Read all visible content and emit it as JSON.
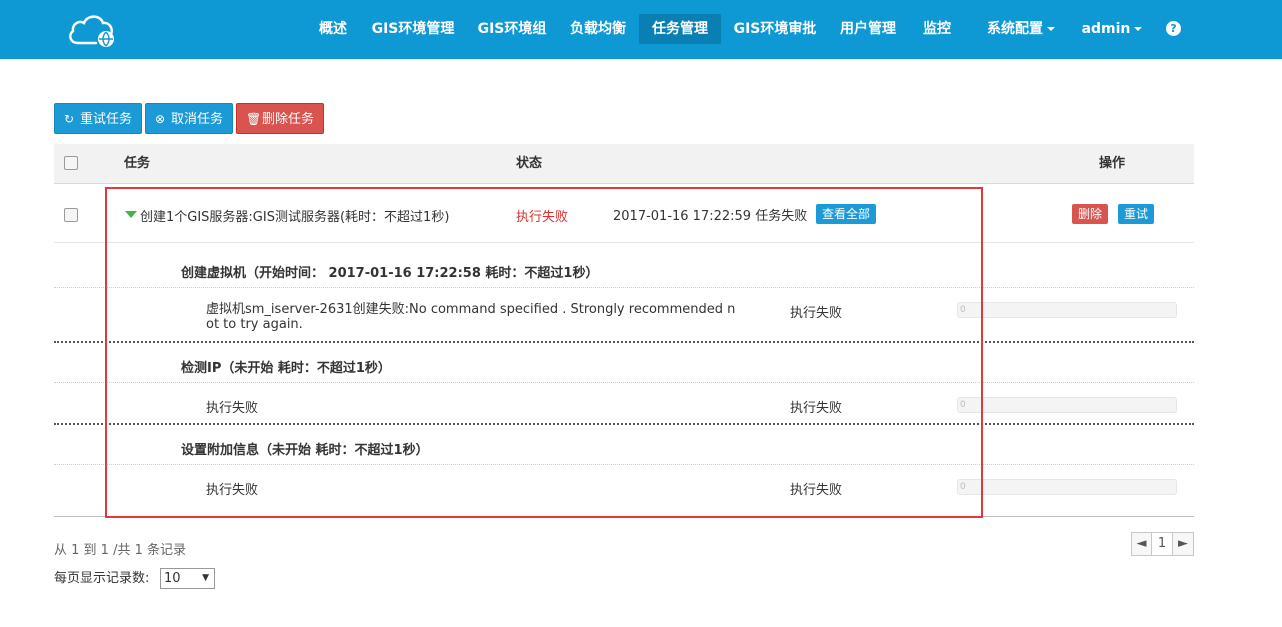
{
  "nav": {
    "items": [
      "概述",
      "GIS环境管理",
      "GIS环境组",
      "负载均衡",
      "任务管理",
      "GIS环境审批",
      "用户管理",
      "监控"
    ],
    "system_config": "系统配置",
    "user": "admin",
    "help": "?",
    "active": "任务管理"
  },
  "toolbar": {
    "retry": "重试任务",
    "cancel": "取消任务",
    "delete": "删除任务"
  },
  "table": {
    "headers": {
      "task": "任务",
      "status": "状态",
      "actions": "操作"
    },
    "task": {
      "name": "创建1个GIS服务器:GIS测试服务器(耗时：不超过1秒)",
      "status": "执行失败",
      "message": "2017-01-16 17:22:59 任务失败",
      "view_all": "查看全部",
      "delete": "删除",
      "retry": "重试"
    },
    "steps": [
      {
        "title": "创建虚拟机（开始时间： 2017-01-16 17:22:58 耗时：不超过1秒）",
        "detail_line1": "虚拟机sm_iserver-2631创建失败:No command specified . Strongly recommended n",
        "detail_line2": "ot to try again.",
        "status": "执行失败",
        "progress": 0,
        "progress_label": "0"
      },
      {
        "title": "检测IP（未开始 耗时：不超过1秒）",
        "detail_line1": "执行失败",
        "status": "执行失败",
        "progress": 0,
        "progress_label": "0"
      },
      {
        "title": "设置附加信息（未开始 耗时：不超过1秒）",
        "detail_line1": "执行失败",
        "status": "执行失败",
        "progress": 0,
        "progress_label": "0"
      }
    ]
  },
  "footer": {
    "summary": "从 1 到 1 /共 1 条记录",
    "per_page_label": "每页显示记录数:",
    "per_page_value": "10",
    "page_prev": "◄",
    "page_current": "1",
    "page_next": "►"
  },
  "colors": {
    "brand": "#0e99d5",
    "danger": "#d9534f",
    "highlight": "#e0383c",
    "expand": "#46b34a"
  }
}
